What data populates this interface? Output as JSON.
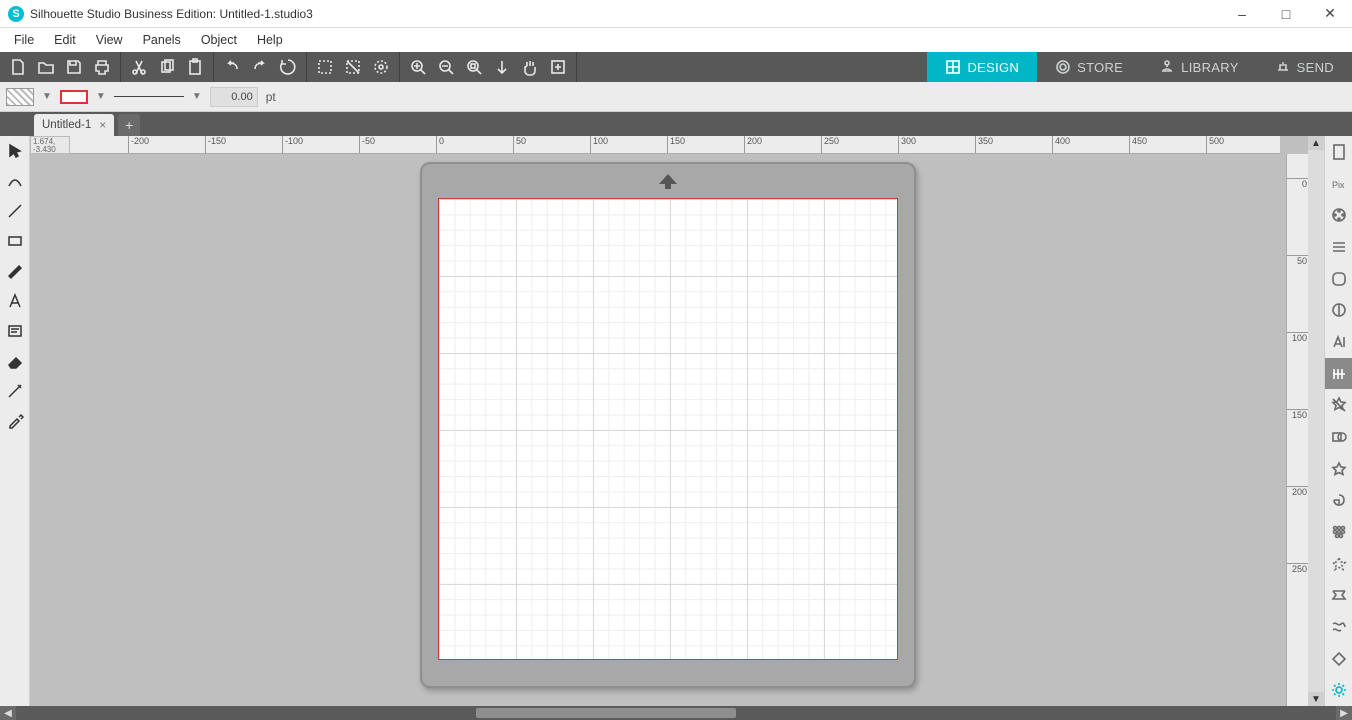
{
  "title": "Silhouette Studio Business Edition: Untitled-1.studio3",
  "menubar": [
    "File",
    "Edit",
    "View",
    "Panels",
    "Object",
    "Help"
  ],
  "mode_tabs": [
    {
      "label": "DESIGN",
      "active": true
    },
    {
      "label": "STORE",
      "active": false
    },
    {
      "label": "LIBRARY",
      "active": false
    },
    {
      "label": "SEND",
      "active": false
    }
  ],
  "props": {
    "line_weight_value": "0.00",
    "line_weight_unit": "pt"
  },
  "doc_tab": {
    "label": "Untitled-1"
  },
  "ruler_corner": "1.674, -3.430",
  "ruler_h_ticks": [
    -200,
    -150,
    -100,
    -50,
    0,
    50,
    100,
    150,
    200,
    250,
    300,
    350,
    400,
    450,
    500
  ],
  "ruler_v_ticks": [
    0,
    50,
    100,
    150,
    200,
    250
  ],
  "left_tools": [
    "select-tool",
    "edit-points-tool",
    "line-tool",
    "rectangle-tool",
    "freehand-tool",
    "text-tool",
    "draw-note-tool",
    "eraser-tool",
    "knife-tool",
    "eyedropper-tool"
  ],
  "right_panels": [
    "page-setup-icon",
    "pixscan-icon",
    "fill-color-icon",
    "line-style-icon",
    "warp-icon",
    "trace-icon",
    "text-style-icon",
    "align-icon",
    "replicate-icon",
    "modify-icon",
    "offset-icon",
    "nesting-icon",
    "rhinestone-icon",
    "sketch-icon",
    "stipple-icon",
    "emboss-icon",
    "barcode-icon"
  ]
}
